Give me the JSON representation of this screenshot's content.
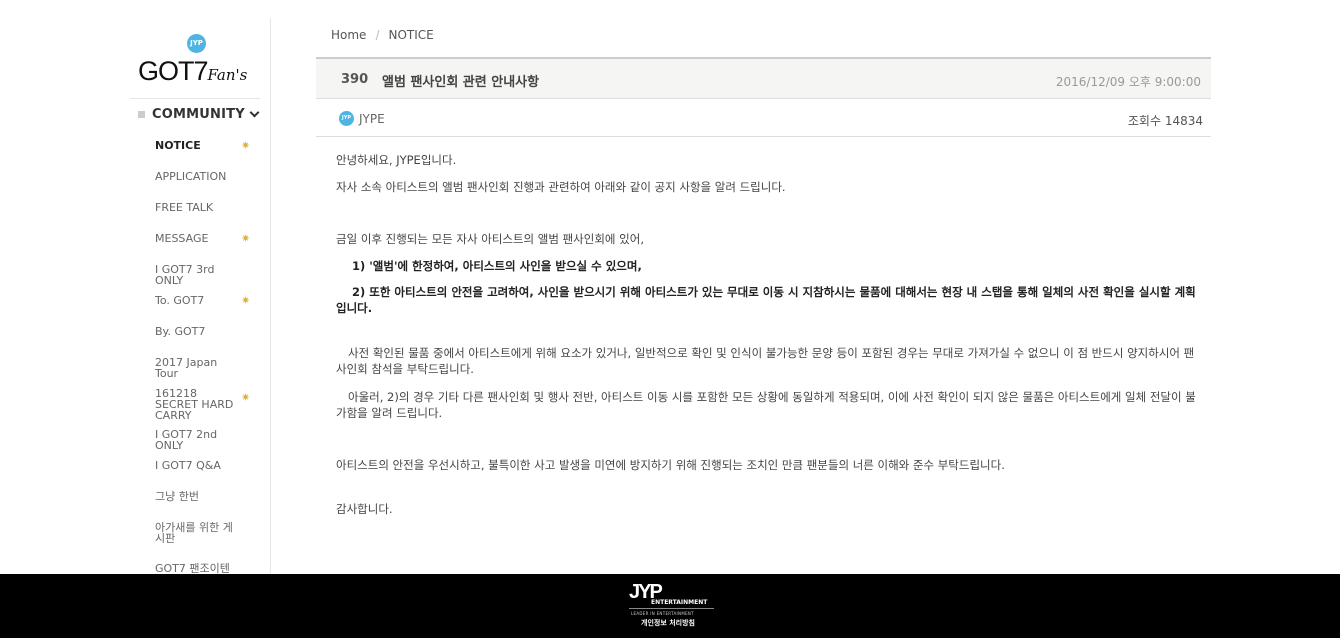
{
  "brand": {
    "badge": "JYP",
    "logo_text": "GOT7",
    "logo_script": "Fan's"
  },
  "sidebar": {
    "section_label": "COMMUNITY",
    "items": [
      {
        "label": "NOTICE",
        "active": true,
        "starred": true
      },
      {
        "label": "APPLICATION",
        "active": false,
        "starred": false
      },
      {
        "label": "FREE TALK",
        "active": false,
        "starred": false
      },
      {
        "label": "MESSAGE",
        "active": false,
        "starred": true
      },
      {
        "label": "I GOT7 3rd ONLY",
        "active": false,
        "starred": false
      },
      {
        "label": "To. GOT7",
        "active": false,
        "starred": true
      },
      {
        "label": "By. GOT7",
        "active": false,
        "starred": false
      },
      {
        "label": "2017 Japan Tour",
        "active": false,
        "starred": false
      },
      {
        "label": "161218 SECRET HARD CARRY",
        "active": false,
        "starred": true
      },
      {
        "label": "I GOT7 2nd ONLY",
        "active": false,
        "starred": false
      },
      {
        "label": "I GOT7 Q&A",
        "active": false,
        "starred": false
      },
      {
        "label": "그냥 한번",
        "active": false,
        "starred": false
      },
      {
        "label": "아가새를 위한 게시판",
        "active": false,
        "starred": false
      },
      {
        "label": "GOT7 팬조이텐",
        "active": false,
        "starred": false
      }
    ],
    "star_glyph": "✷"
  },
  "breadcrumb": {
    "home": "Home",
    "separator": "/",
    "current": "NOTICE"
  },
  "post": {
    "number": "390",
    "title": "앨범 팬사인회 관련 안내사항",
    "date": "2016/12/09 오후 9:00:00",
    "author_badge": "JYP",
    "author": "JYPE",
    "views": "조회수 14834",
    "paragraphs": [
      "안녕하세요, JYPE입니다.",
      "자사 소속 아티스트의 앨범 팬사인회 진행과 관련하여 아래와 같이 공지 사항을 알려 드립니다.",
      "금일 이후 진행되는 모든 자사 아티스트의 앨범 팬사인회에 있어,",
      "1) '앨범'에 한정하여, 아티스트의 사인을 받으실 수 있으며,",
      "2) 또한 아티스트의 안전을 고려하여, 사인을 받으시기 위해 아티스트가 있는 무대로 이동 시 지참하시는 물품에 대해서는 현장 내 스탭을 통해 일체의 사전 확인을 실시할 계획입니다.",
      "사전 확인된 물품 중에서 아티스트에게 위해 요소가 있거나, 일반적으로 확인 및 인식이 불가능한 문양 등이 포함된 경우는 무대로 가져가실 수 없으니 이 점 반드시 양지하시어 팬사인회 참석을 부탁드립니다.",
      "아울러, 2)의 경우 기타 다른 팬사인회 및 행사 전반, 아티스트 이동 시를 포함한 모든 상황에 동일하게 적용되며, 이에 사전 확인이 되지 않은 물품은 아티스트에게 일체 전달이 불가함을 알려 드립니다.",
      "아티스트의 안전을 우선시하고, 불특이한 사고 발생을 미연에 방지하기 위해 진행되는 조치인 만큼 팬분들의 너른 이해와 준수 부탁드립니다.",
      "감사합니다."
    ]
  },
  "footer": {
    "logo": "JYP",
    "logo_sub": "ENTERTAINMENT",
    "tagline": "LEADER IN ENTERTAINMENT",
    "privacy": "개인정보 처리방침"
  },
  "colors": {
    "accent_blue": "#4fb4e4",
    "star_gold": "#d8b33b",
    "footer_bg": "#000000"
  }
}
